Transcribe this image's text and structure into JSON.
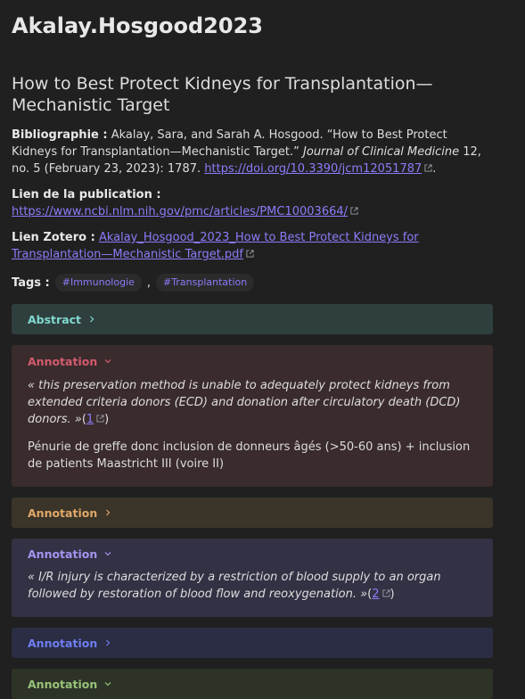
{
  "page_title": "Akalay.Hosgood2023",
  "article_title": "How to Best Protect Kidneys for Transplantation—Mechanistic Target",
  "bibliography": {
    "label": "Bibliographie :",
    "text_before": "Akalay, Sara, and Sarah A. Hosgood. “How to Best Protect Kidneys for Transplantation—Mechanistic Target.”",
    "journal": "Journal of Clinical Medicine",
    "text_after": "12, no. 5 (February 23, 2023): 1787.",
    "doi": "https://doi.org/10.3390/jcm12051787",
    "end": "."
  },
  "publication": {
    "label": "Lien de la publication :",
    "url": "https://www.ncbi.nlm.nih.gov/pmc/articles/PMC10003664/"
  },
  "zotero": {
    "label": "Lien Zotero :",
    "file": "Akalay_Hosgood_2023_How to Best Protect Kidneys for Transplantation—Mechanistic Target.pdf"
  },
  "tags": {
    "label": "Tags :",
    "items": [
      "#Immunologie",
      "#Transplantation"
    ],
    "separator": ","
  },
  "callouts": [
    {
      "title": "Abstract",
      "collapsed": true,
      "color": "#7fd9d0"
    },
    {
      "title": "Annotation",
      "collapsed": false,
      "color": "#d35b6d",
      "quote": "« this preservation method is unable to adequately protect kidneys from extended criteria donors (ECD) and donation after circulatory death (DCD) donors. »",
      "ref_open": "(",
      "ref": "1",
      "ref_close": ")",
      "note": "Pénurie de greffe donc inclusion de donneurs âgés (>50-60 ans) + inclusion de patients Maastricht III (voire II)"
    },
    {
      "title": "Annotation",
      "collapsed": true,
      "color": "#e0a86a"
    },
    {
      "title": "Annotation",
      "collapsed": false,
      "color": "#a394f0",
      "quote": "« I/R injury is characterized by a restriction of blood supply to an organ followed by restoration of blood flow and reoxygenation. »",
      "ref_open": "(",
      "ref": "2",
      "ref_close": ")"
    },
    {
      "title": "Annotation",
      "collapsed": true,
      "color": "#6f7ef0"
    },
    {
      "title": "Annotation",
      "collapsed": false,
      "color": "#98c379"
    }
  ]
}
